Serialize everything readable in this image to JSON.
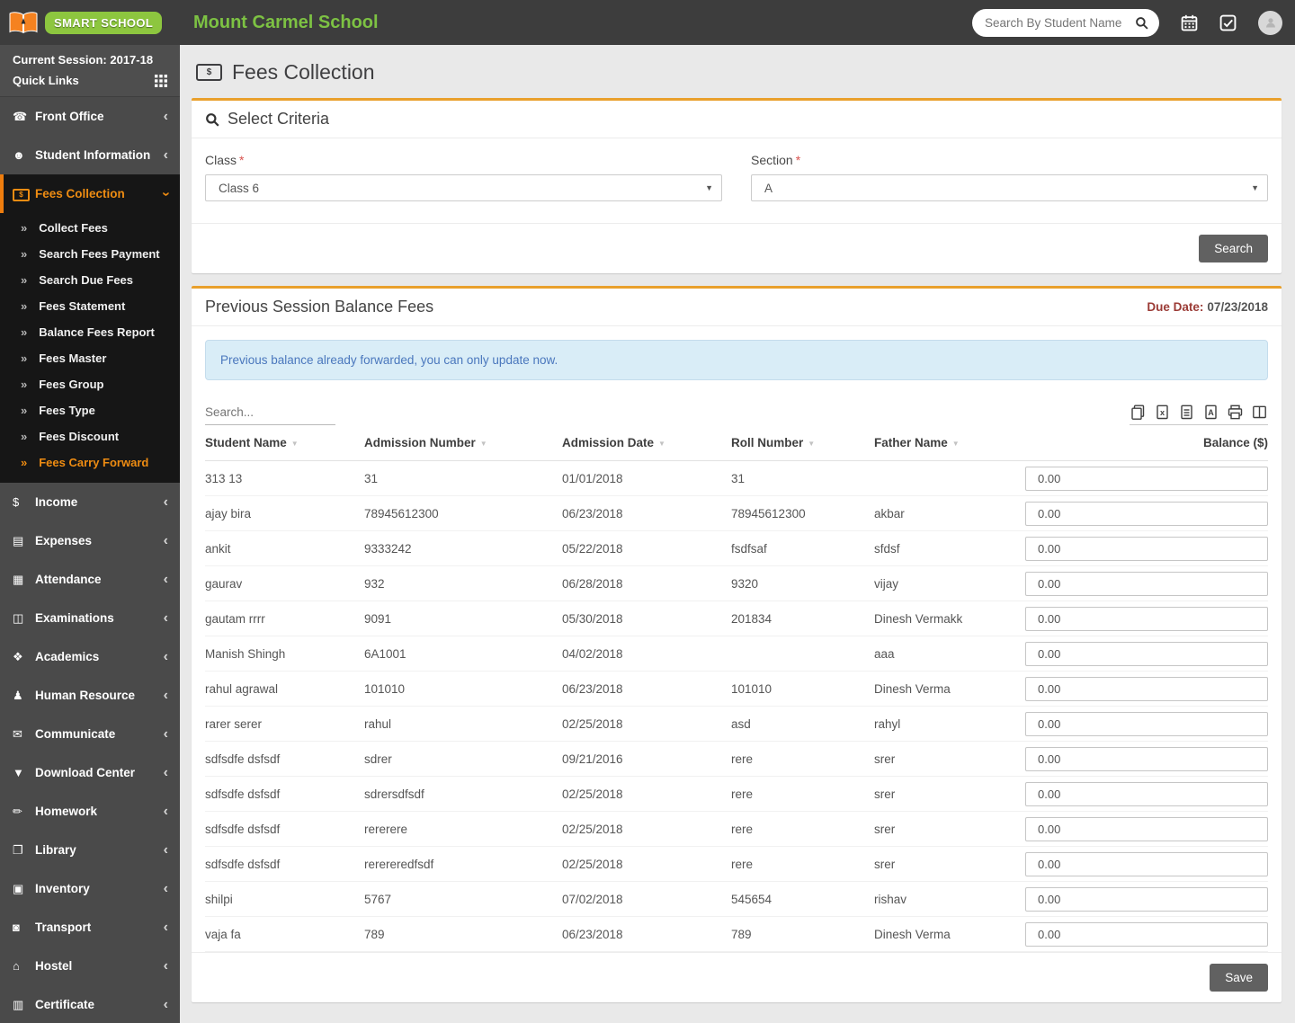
{
  "header": {
    "brand": "SMART SCHOOL",
    "school_name": "Mount Carmel School",
    "search_placeholder": "Search By Student Name"
  },
  "sidebar": {
    "session": "Current Session: 2017-18",
    "quick_links": "Quick Links",
    "items": [
      {
        "id": "front-office",
        "label": "Front Office",
        "glyph": "☎"
      },
      {
        "id": "student-information",
        "label": "Student Information",
        "glyph": "☻"
      },
      {
        "id": "fees-collection",
        "label": "Fees Collection",
        "glyph": "$",
        "bill": true,
        "active": true,
        "submenu": [
          {
            "id": "collect-fees",
            "label": "Collect Fees"
          },
          {
            "id": "search-fees-payment",
            "label": "Search Fees Payment"
          },
          {
            "id": "search-due-fees",
            "label": "Search Due Fees"
          },
          {
            "id": "fees-statement",
            "label": "Fees Statement"
          },
          {
            "id": "balance-fees-report",
            "label": "Balance Fees Report"
          },
          {
            "id": "fees-master",
            "label": "Fees Master"
          },
          {
            "id": "fees-group",
            "label": "Fees Group"
          },
          {
            "id": "fees-type",
            "label": "Fees Type"
          },
          {
            "id": "fees-discount",
            "label": "Fees Discount"
          },
          {
            "id": "fees-carry-forward",
            "label": "Fees Carry Forward",
            "active": true
          }
        ]
      },
      {
        "id": "income",
        "label": "Income",
        "glyph": "$"
      },
      {
        "id": "expenses",
        "label": "Expenses",
        "glyph": "▤"
      },
      {
        "id": "attendance",
        "label": "Attendance",
        "glyph": "▦"
      },
      {
        "id": "examinations",
        "label": "Examinations",
        "glyph": "◫"
      },
      {
        "id": "academics",
        "label": "Academics",
        "glyph": "❖"
      },
      {
        "id": "human-resource",
        "label": "Human Resource",
        "glyph": "♟"
      },
      {
        "id": "communicate",
        "label": "Communicate",
        "glyph": "✉"
      },
      {
        "id": "download-center",
        "label": "Download Center",
        "glyph": "▼"
      },
      {
        "id": "homework",
        "label": "Homework",
        "glyph": "✏"
      },
      {
        "id": "library",
        "label": "Library",
        "glyph": "❐"
      },
      {
        "id": "inventory",
        "label": "Inventory",
        "glyph": "▣"
      },
      {
        "id": "transport",
        "label": "Transport",
        "glyph": "◙"
      },
      {
        "id": "hostel",
        "label": "Hostel",
        "glyph": "⌂"
      },
      {
        "id": "certificate",
        "label": "Certificate",
        "glyph": "▥"
      }
    ]
  },
  "page": {
    "title": "Fees Collection"
  },
  "criteria": {
    "title": "Select Criteria",
    "class_label": "Class",
    "class_value": "Class 6",
    "section_label": "Section",
    "section_value": "A",
    "required_marker": "*",
    "search_button": "Search"
  },
  "balance_panel": {
    "title": "Previous Session Balance Fees",
    "due_date_label": "Due Date:",
    "due_date_value": "07/23/2018",
    "alert_message": "Previous balance already forwarded, you can only update now.",
    "search_placeholder": "Search...",
    "export_icons": [
      "copy-export-icon",
      "excel-export-icon",
      "csv-export-icon",
      "pdf-export-icon",
      "print-icon",
      "column-visibility-icon"
    ],
    "columns": [
      {
        "label": "Student Name",
        "sortable": true
      },
      {
        "label": "Admission Number",
        "sortable": true
      },
      {
        "label": "Admission Date",
        "sortable": true
      },
      {
        "label": "Roll Number",
        "sortable": true
      },
      {
        "label": "Father Name",
        "sortable": true
      },
      {
        "label": "Balance ($)",
        "sortable": false
      }
    ],
    "rows": [
      {
        "student_name": "313 13",
        "admission_number": "31",
        "admission_date": "01/01/2018",
        "roll_number": "31",
        "father_name": "",
        "balance": "0.00"
      },
      {
        "student_name": "ajay bira",
        "admission_number": "78945612300",
        "admission_date": "06/23/2018",
        "roll_number": "78945612300",
        "father_name": "akbar",
        "balance": "0.00"
      },
      {
        "student_name": "ankit",
        "admission_number": "9333242",
        "admission_date": "05/22/2018",
        "roll_number": "fsdfsaf",
        "father_name": "sfdsf",
        "balance": "0.00"
      },
      {
        "student_name": "gaurav",
        "admission_number": "932",
        "admission_date": "06/28/2018",
        "roll_number": "9320",
        "father_name": "vijay",
        "balance": "0.00"
      },
      {
        "student_name": "gautam rrrr",
        "admission_number": "9091",
        "admission_date": "05/30/2018",
        "roll_number": "201834",
        "father_name": "Dinesh Vermakk",
        "balance": "0.00"
      },
      {
        "student_name": "Manish Shingh",
        "admission_number": "6A1001",
        "admission_date": "04/02/2018",
        "roll_number": "",
        "father_name": "aaa",
        "balance": "0.00"
      },
      {
        "student_name": "rahul agrawal",
        "admission_number": "101010",
        "admission_date": "06/23/2018",
        "roll_number": "101010",
        "father_name": "Dinesh Verma",
        "balance": "0.00"
      },
      {
        "student_name": "rarer serer",
        "admission_number": "rahul",
        "admission_date": "02/25/2018",
        "roll_number": "asd",
        "father_name": "rahyl",
        "balance": "0.00"
      },
      {
        "student_name": "sdfsdfe dsfsdf",
        "admission_number": "sdrer",
        "admission_date": "09/21/2016",
        "roll_number": "rere",
        "father_name": "srer",
        "balance": "0.00"
      },
      {
        "student_name": "sdfsdfe dsfsdf",
        "admission_number": "sdrersdfsdf",
        "admission_date": "02/25/2018",
        "roll_number": "rere",
        "father_name": "srer",
        "balance": "0.00"
      },
      {
        "student_name": "sdfsdfe dsfsdf",
        "admission_number": "rererere",
        "admission_date": "02/25/2018",
        "roll_number": "rere",
        "father_name": "srer",
        "balance": "0.00"
      },
      {
        "student_name": "sdfsdfe dsfsdf",
        "admission_number": "rerereredfsdf",
        "admission_date": "02/25/2018",
        "roll_number": "rere",
        "father_name": "srer",
        "balance": "0.00"
      },
      {
        "student_name": "shilpi",
        "admission_number": "5767",
        "admission_date": "07/02/2018",
        "roll_number": "545654",
        "father_name": "rishav",
        "balance": "0.00"
      },
      {
        "student_name": "vaja fa",
        "admission_number": "789",
        "admission_date": "06/23/2018",
        "roll_number": "789",
        "father_name": "Dinesh Verma",
        "balance": "0.00"
      }
    ],
    "save_button": "Save"
  },
  "colors": {
    "accent_orange": "#ee7d0e",
    "panel_border_orange": "#e9a02c",
    "brand_green": "#7dc243",
    "logo_pill_green": "#8dc63f",
    "alert_bg": "#d9edf7",
    "alert_text": "#4a77bd",
    "due_date_red": "#9b3b36",
    "topbar_bg": "#3d3d3d",
    "sidebar_bg": "#4a4a4a",
    "active_menu_bg": "#161616"
  }
}
